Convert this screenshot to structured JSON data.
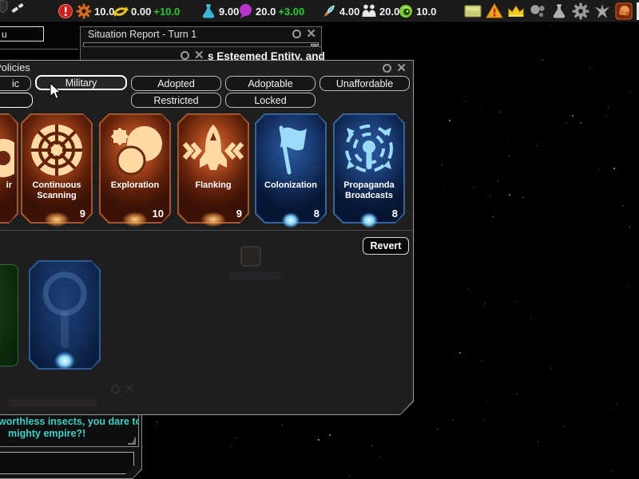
{
  "top_bar": {
    "stats": [
      {
        "icon": "gear-icon",
        "value": "10.0",
        "delta": ""
      },
      {
        "icon": "coins-icon",
        "value": "0.00",
        "delta": "+10.0"
      },
      {
        "icon": "flask-icon",
        "value": "9.00",
        "delta": ""
      },
      {
        "icon": "chat-bubble-icon",
        "value": "20.0",
        "delta": "+3.00"
      },
      {
        "icon": "rocket-icon",
        "value": "4.00",
        "delta": ""
      },
      {
        "icon": "population-icon",
        "value": "20.0",
        "delta": ""
      },
      {
        "icon": "eye-icon",
        "value": "10.0",
        "delta": ""
      }
    ],
    "delta_color": "#29cc29"
  },
  "menu": {
    "tab_label": "u"
  },
  "situation_report": {
    "title": "Situation Report - Turn 1"
  },
  "letter_fragment": {
    "text": "s Esteemed Entity, and"
  },
  "policies": {
    "title": "Policies",
    "row1": [
      {
        "label": "ic"
      },
      {
        "label": "Military"
      },
      {
        "label": "Adopted"
      },
      {
        "label": "Adoptable"
      },
      {
        "label": "Unaffordable"
      }
    ],
    "row2": [
      {
        "label": ""
      },
      {
        "label": "Restricted"
      },
      {
        "label": "Locked"
      }
    ],
    "cards": [
      {
        "name": "ir",
        "cost": "",
        "theme": "orange"
      },
      {
        "name": "Continuous Scanning",
        "cost": "9",
        "theme": "orange"
      },
      {
        "name": "Exploration",
        "cost": "10",
        "theme": "orange"
      },
      {
        "name": "Flanking",
        "cost": "9",
        "theme": "orange"
      },
      {
        "name": "Colonization",
        "cost": "8",
        "theme": "blue"
      },
      {
        "name": "Propaganda Broadcasts",
        "cost": "8",
        "theme": "blue"
      }
    ],
    "revert_label": "Revert"
  },
  "dialog": {
    "line1": "worthless insects, you dare to",
    "line2": "mighty empire?!",
    "text_color": "#3fd0c8"
  },
  "icons": {
    "close_glyph": "✕"
  }
}
